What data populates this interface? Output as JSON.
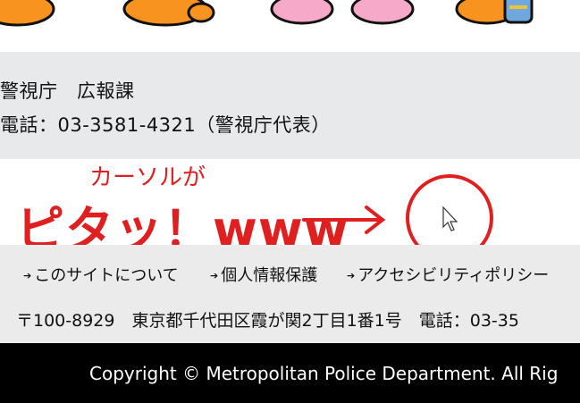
{
  "contact": {
    "department": "警視庁　広報課",
    "phone": "電話：03-3581-4321（警視庁代表）"
  },
  "annotation": {
    "small_text": "カーソルが",
    "big_text": "ピタッ！www",
    "color": "#e02020"
  },
  "footer": {
    "links": [
      {
        "label": "このサイトについて"
      },
      {
        "label": "個人情報保護"
      },
      {
        "label": "アクセシビリティポリシー"
      }
    ],
    "address": "〒100-8929　東京都千代田区霞が関2丁目1番1号　電話：03-35"
  },
  "copyright": "Copyright © Metropolitan Police Department. All Rig"
}
